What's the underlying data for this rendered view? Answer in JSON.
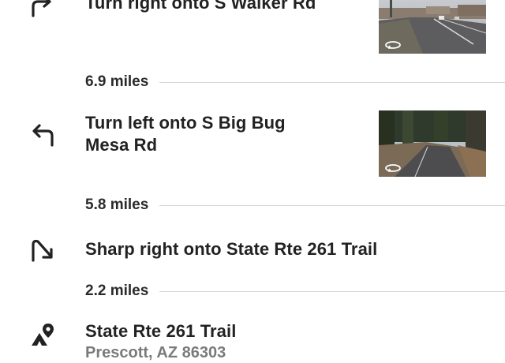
{
  "steps": [
    {
      "instruction": "Turn right onto S Walker Rd",
      "icon": "turn-right-icon",
      "has_street_view": true
    },
    {
      "instruction_line1": "Turn left onto S Big Bug",
      "instruction_line2": "Mesa Rd",
      "icon": "turn-left-icon",
      "has_street_view": true
    },
    {
      "instruction": "Sharp right onto State Rte 261 Trail",
      "icon": "sharp-right-icon",
      "has_street_view": false
    }
  ],
  "distances": [
    "6.9 miles",
    "5.8 miles",
    "2.2 miles"
  ],
  "destination": {
    "name": "State Rte 261 Trail",
    "address": "Prescott, AZ 86303",
    "icon": "destination-pin-icon"
  },
  "colors": {
    "text": "#222222",
    "secondary_text": "#7a7a7a",
    "divider": "#d7d7d7"
  }
}
